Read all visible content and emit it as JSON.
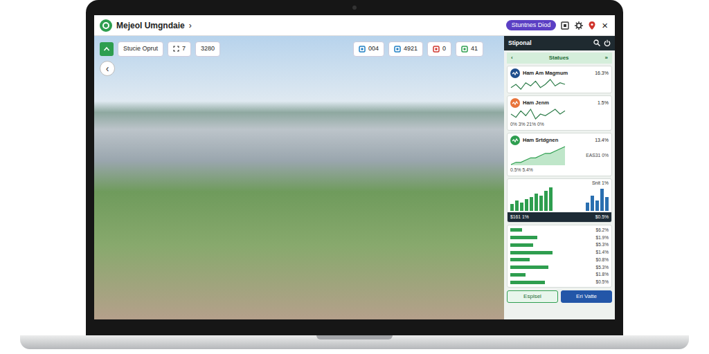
{
  "window": {
    "title": "Mejeol Umgndaie",
    "caret": "›",
    "badge": "Stuntnes Diod",
    "close": "×"
  },
  "map": {
    "mode_label": "Stucie Oprut",
    "zoom": "7",
    "count": "3280",
    "back": "‹",
    "stats": [
      {
        "value": "004",
        "color": "#1e7fc4"
      },
      {
        "value": "4921",
        "color": "#1e7fc4"
      },
      {
        "value": "0",
        "color": "#d0342c"
      },
      {
        "value": "41",
        "color": "#2e9e4f"
      }
    ]
  },
  "panel": {
    "title": "Stiponal",
    "tab": {
      "prev": "‹",
      "label": "Statues",
      "next": "»"
    },
    "metrics": [
      {
        "kind": "line",
        "name": "Ham Am Magmum",
        "value": "16.3%",
        "color": "#1f4e8c",
        "series": [
          5,
          7,
          4,
          8,
          6,
          9,
          5,
          7,
          10,
          6,
          8,
          7
        ]
      },
      {
        "kind": "line",
        "name": "Ham Jenm",
        "value": "1.5%",
        "detail": "0%   3%   21%   0%",
        "color": "#e8743b",
        "series": [
          6,
          4,
          8,
          5,
          9,
          3,
          6,
          5,
          7,
          9,
          6,
          8
        ]
      },
      {
        "kind": "area",
        "name": "Ham Srtdgnen",
        "value": "13.4%",
        "detail": "0.5%   5.4%",
        "note": "EAS31 0%",
        "color": "#2e9e4f",
        "series": [
          2,
          3,
          3,
          4,
          5,
          5,
          6,
          7,
          7,
          8,
          9,
          10
        ]
      }
    ],
    "bar_chart": {
      "title": "Snit 1%",
      "series": [
        {
          "color": "#2e9e4f",
          "values": [
            8,
            12,
            10,
            14,
            16,
            20,
            18,
            24,
            28
          ]
        },
        {
          "color": "#2a6fb0",
          "values": [
            10,
            18,
            12,
            26,
            16
          ]
        }
      ],
      "footer": [
        "$161 1%",
        "$0.5%"
      ]
    },
    "hbars": [
      {
        "value": "$6.2%",
        "level": 0.15
      },
      {
        "value": "$1.9%",
        "level": 0.35
      },
      {
        "value": "$5.3%",
        "level": 0.3
      },
      {
        "value": "$1.4%",
        "level": 0.55
      },
      {
        "value": "$0.8%",
        "level": 0.25
      },
      {
        "value": "$5.3%",
        "level": 0.5
      },
      {
        "value": "$1.8%",
        "level": 0.2
      },
      {
        "value": "$0.5%",
        "level": 0.45
      }
    ],
    "buttons": [
      {
        "label": "Esplsel",
        "selected": false
      },
      {
        "label": "Eri Vatte",
        "selected": true
      }
    ]
  }
}
